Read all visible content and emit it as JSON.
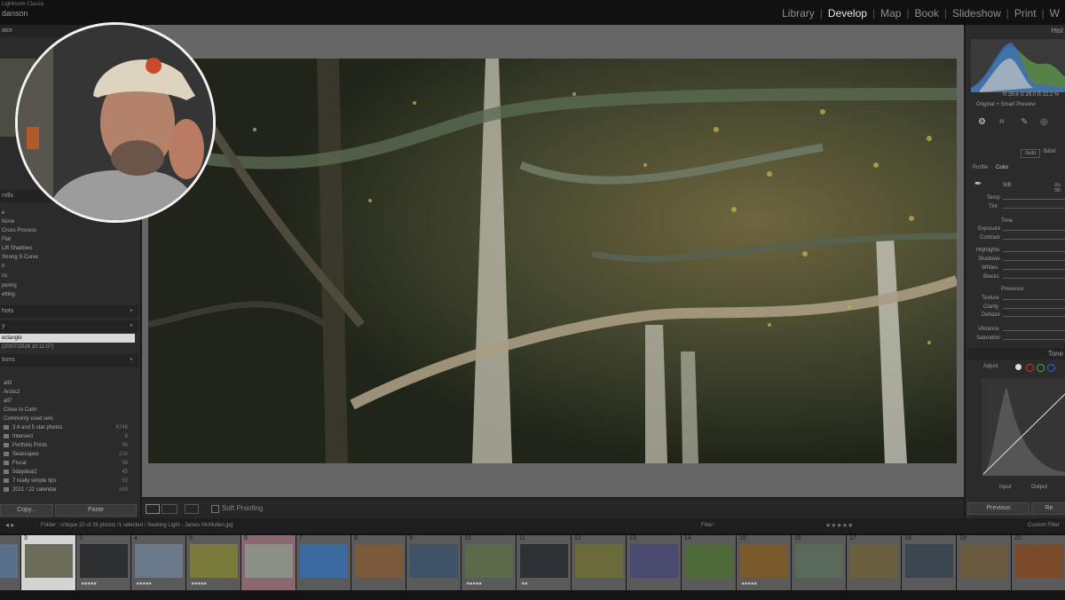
{
  "app": {
    "name": "Lightroom Classic",
    "user": "danson"
  },
  "modules": [
    "Library",
    "Develop",
    "Map",
    "Book",
    "Slideshow",
    "Print",
    "W"
  ],
  "active_module": "Develop",
  "left_panel": {
    "navigator_title": "ator",
    "preset_group_label": "rolls",
    "presets": [
      "e",
      "None",
      "Cross Process",
      "Flat",
      "Lift Shadows",
      "Strong S Curve",
      "n",
      "cs",
      "pering",
      "etting"
    ],
    "snapshots_title": "hots",
    "history_title": "y",
    "history_selected": "ectangle",
    "history_item": "(20/07/2026 10:11:07)",
    "collections_title": "tions",
    "collections": [
      {
        "name": "all3",
        "count": ""
      },
      {
        "name": "Arctic2",
        "count": ""
      },
      {
        "name": "all7",
        "count": ""
      },
      {
        "name": "Close to Calm",
        "count": ""
      },
      {
        "name": "Commonly used sets",
        "count": ""
      },
      {
        "name": "3.4 and 5 star photos",
        "count": "6748"
      },
      {
        "name": "Intersect",
        "count": "8"
      },
      {
        "name": "Portfolio Prints",
        "count": "96"
      },
      {
        "name": "Seascapes",
        "count": "216"
      },
      {
        "name": "Fiscal",
        "count": "58"
      },
      {
        "name": "5daydeal2",
        "count": "45"
      },
      {
        "name": "7 really simple tips",
        "count": "53"
      },
      {
        "name": "2021 / 22 calendar",
        "count": "160"
      }
    ],
    "copy_label": "Copy...",
    "paste_label": "Paste"
  },
  "toolbar": {
    "soft_proofing_label": "Soft Proofing"
  },
  "right_panel": {
    "histogram_title": "Hist",
    "rgb_readout": "R 26.6  G 26.0  B 22.2 %",
    "preview_label": "Original + Smart Preview",
    "auto_label": "Auto",
    "bw_label": "B&W",
    "profile_label": "Profile",
    "profile_value": "Color",
    "wb_label": "WB",
    "wb_value": "As Sh",
    "basic_sliders_1": [
      "Temp",
      "Tint"
    ],
    "tone_title": "Tone",
    "tone_sliders": [
      "Exposure",
      "Contrast",
      "Highlights",
      "Shadows",
      "Whites",
      "Blacks"
    ],
    "presence_title": "Presence",
    "presence_sliders": [
      "Texture",
      "Clarity",
      "Dehaze",
      "Vibrance",
      "Saturation"
    ],
    "tone_curve_title": "Tone",
    "adjust_label": "Adjust",
    "curve_input_label": "Input",
    "curve_output_label": "Output",
    "previous_label": "Previous",
    "reset_label": "Re"
  },
  "filmstrip": {
    "source_text": "Folder : critique    20 of 26 photos /1 selected / Seeking Light - James McMullen.jpg",
    "filter_label": "Filter :",
    "custom_filter_label": "Custom Filter",
    "cells": [
      {
        "num": "",
        "stars": ""
      },
      {
        "num": "3",
        "stars": ""
      },
      {
        "num": "3",
        "stars": "★★★★★"
      },
      {
        "num": "4",
        "stars": "★★★★★"
      },
      {
        "num": "5",
        "stars": "★★★★★"
      },
      {
        "num": "6",
        "stars": ""
      },
      {
        "num": "7",
        "stars": ""
      },
      {
        "num": "8",
        "stars": ""
      },
      {
        "num": "9",
        "stars": ""
      },
      {
        "num": "10",
        "stars": "★★★★★"
      },
      {
        "num": "11",
        "stars": "★★"
      },
      {
        "num": "12",
        "stars": ""
      },
      {
        "num": "13",
        "stars": ""
      },
      {
        "num": "14",
        "stars": ""
      },
      {
        "num": "15",
        "stars": "★★★★★"
      },
      {
        "num": "16",
        "stars": ""
      },
      {
        "num": "17",
        "stars": ""
      },
      {
        "num": "18",
        "stars": ""
      },
      {
        "num": "19",
        "stars": ""
      },
      {
        "num": "20",
        "stars": ""
      }
    ]
  }
}
